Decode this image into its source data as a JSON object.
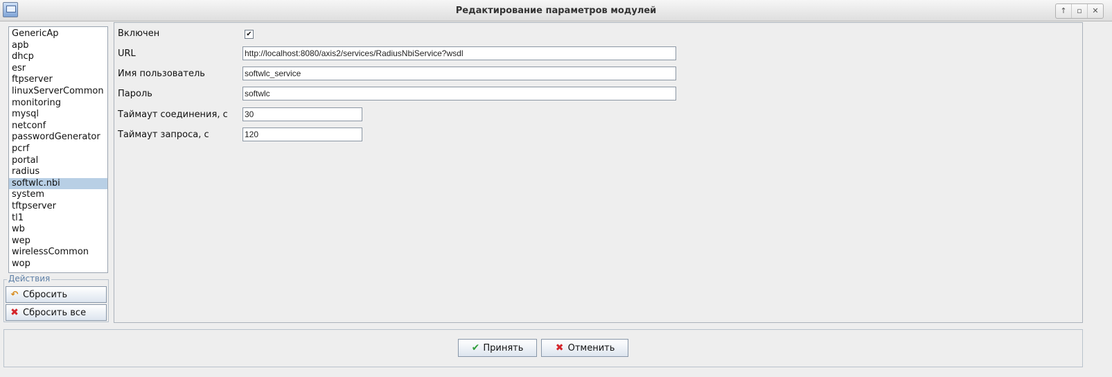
{
  "window": {
    "title": "Редактирование параметров модулей",
    "controls": [
      "↑",
      "▫",
      "✕"
    ]
  },
  "modules": {
    "items": [
      "GenericAp",
      "apb",
      "dhcp",
      "esr",
      "ftpserver",
      "linuxServerCommon",
      "monitoring",
      "mysql",
      "netconf",
      "passwordGenerator",
      "pcrf",
      "portal",
      "radius",
      "softwlc.nbi",
      "system",
      "tftpserver",
      "tl1",
      "wb",
      "wep",
      "wirelessCommon",
      "wop"
    ],
    "selected": "softwlc.nbi"
  },
  "actions": {
    "label": "Действия",
    "reset_label": "Сбросить",
    "reset_all_label": "Сбросить все"
  },
  "form": {
    "enabled_label": "Включен",
    "enabled_mark": "✔",
    "url_label": "URL",
    "url_value": "http://localhost:8080/axis2/services/RadiusNbiService?wsdl",
    "user_label": "Имя пользователь",
    "user_value": "softwlc_service",
    "password_label": "Пароль",
    "password_value": "softwlc",
    "conn_timeout_label": "Таймаут соединения, с",
    "conn_timeout_value": "30",
    "req_timeout_label": "Таймаут запроса, с",
    "req_timeout_value": "120"
  },
  "dialog": {
    "accept_label": "Принять",
    "cancel_label": "Отменить"
  },
  "colors": {
    "selection": "#b8cfe5",
    "accent_text": "#5d7fa6",
    "check_green": "#2f9e3a",
    "cross_red": "#d4242a"
  }
}
